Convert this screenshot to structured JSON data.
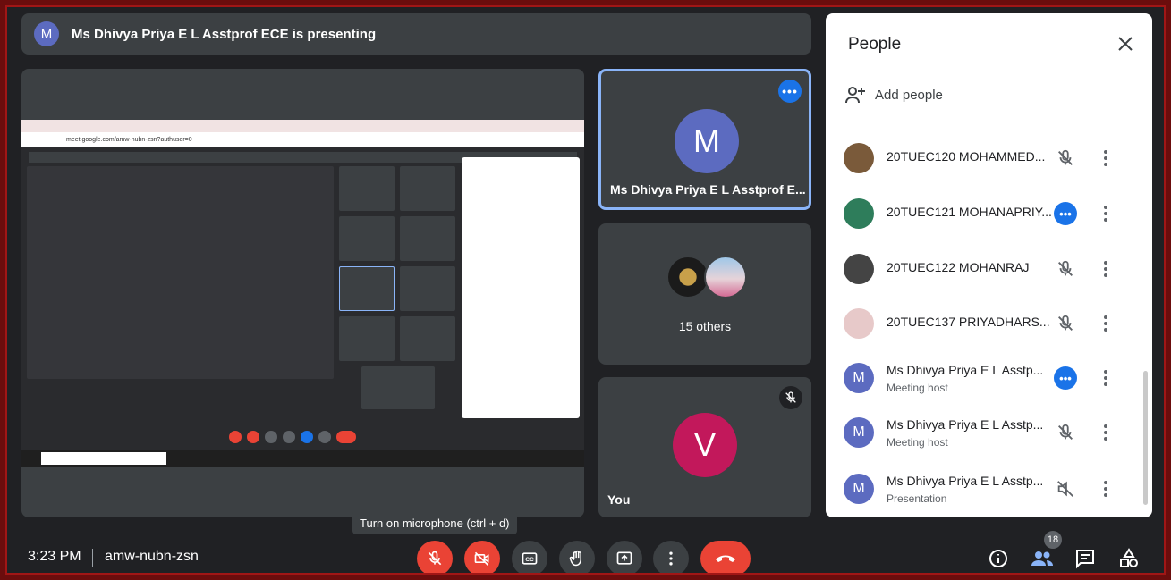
{
  "banner": {
    "avatar_letter": "M",
    "text": "Ms Dhivya Priya E L Asstprof ECE is presenting"
  },
  "tiles": {
    "presenter": {
      "avatar_letter": "M",
      "name": "Ms Dhivya Priya E L Asstprof E...",
      "more_label": "•••"
    },
    "others": {
      "label": "15 others"
    },
    "you": {
      "avatar_letter": "V",
      "name": "You"
    }
  },
  "people_panel": {
    "title": "People",
    "add_people": "Add people",
    "participants": [
      {
        "name": "20TUEC120 MOHAMMED...",
        "sub": "",
        "status": "muted",
        "avatar_color": "#7a5a3a"
      },
      {
        "name": "20TUEC121 MOHANAPRIY...",
        "sub": "",
        "status": "active",
        "avatar_color": "#2e7d5b"
      },
      {
        "name": "20TUEC122 MOHANRAJ",
        "sub": "",
        "status": "muted",
        "avatar_color": "#444444"
      },
      {
        "name": "20TUEC137 PRIYADHARS...",
        "sub": "",
        "status": "muted",
        "avatar_color": "#e7c9c9"
      },
      {
        "name": "Ms Dhivya Priya E L Asstp...",
        "sub": "Meeting host",
        "status": "active",
        "avatar_color": "#5c6bc0",
        "letter": "M"
      },
      {
        "name": "Ms Dhivya Priya E L Asstp...",
        "sub": "Meeting host",
        "status": "muted",
        "avatar_color": "#5c6bc0",
        "letter": "M"
      },
      {
        "name": "Ms Dhivya Priya E L Asstp...",
        "sub": "Presentation",
        "status": "presenting",
        "avatar_color": "#5c6bc0",
        "letter": "M"
      }
    ]
  },
  "tooltip": "Turn on microphone (ctrl + d)",
  "bottom_bar": {
    "time": "3:23 PM",
    "meeting_code": "amw-nubn-zsn",
    "participant_count": "18"
  },
  "shared_screen": {
    "url": "meet.google.com/amw-nubn-zsn?authuser=0"
  },
  "colors": {
    "background": "#202124",
    "tile": "#3c4043",
    "accent_blue": "#1a73e8",
    "danger_red": "#ea4335",
    "presenter_avatar": "#5c6bc0",
    "you_avatar": "#c2185b"
  }
}
